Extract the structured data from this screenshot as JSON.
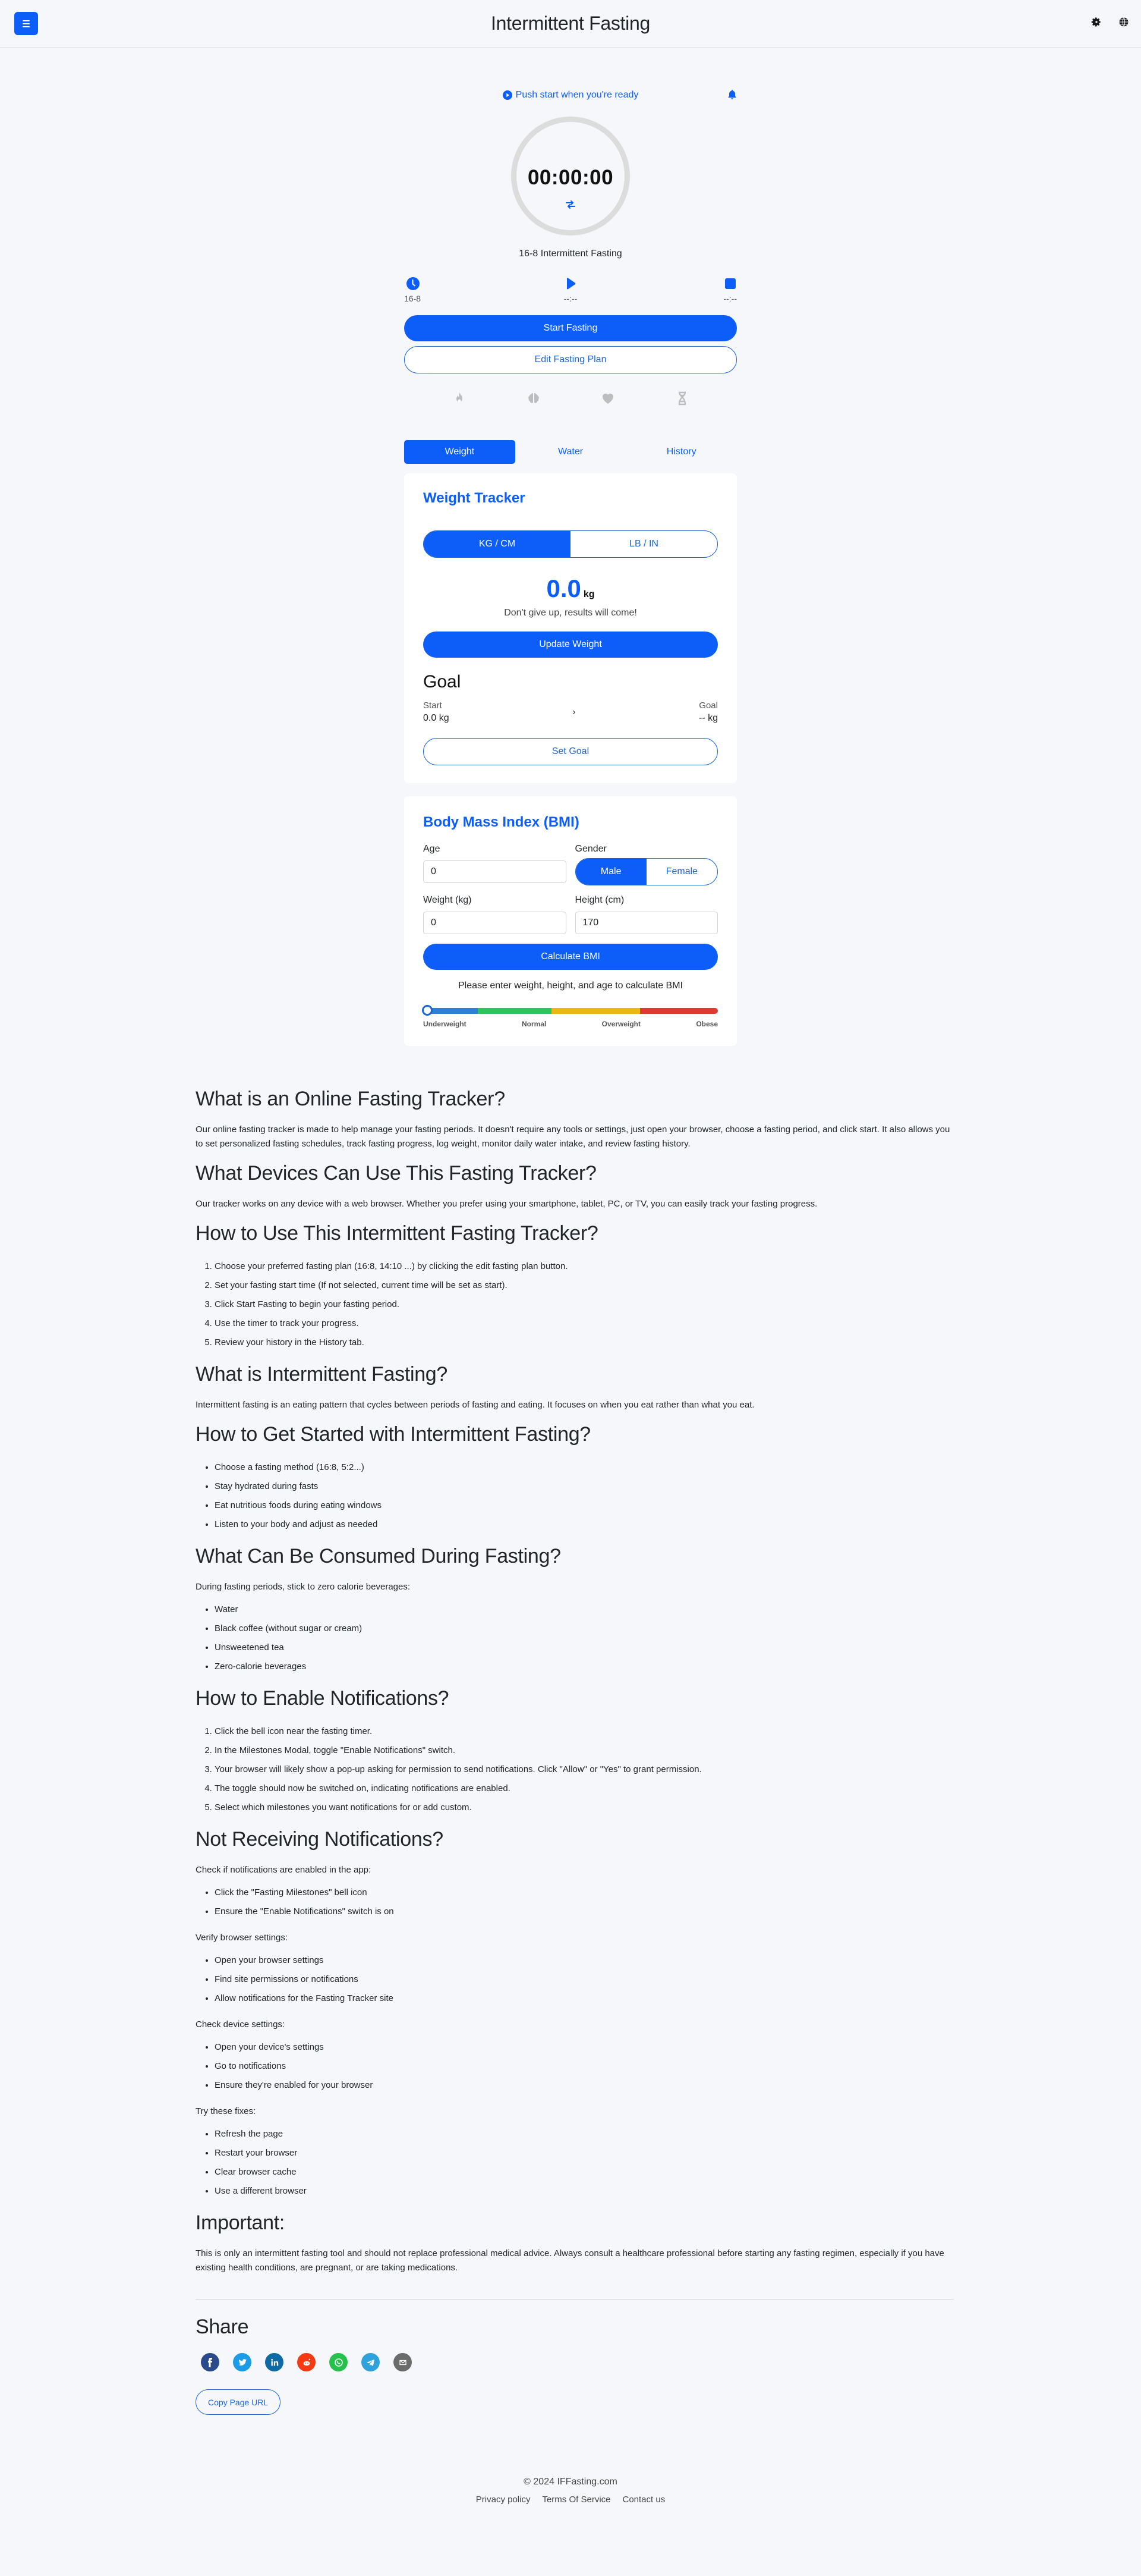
{
  "header": {
    "title": "Intermittent Fasting",
    "menu_icon": "hamburger-menu-icon",
    "settings_icon": "gear-icon",
    "language_icon": "globe-icon"
  },
  "timer": {
    "status_text": "Push start when you're ready",
    "status_icon": "play-circle-icon",
    "notifications_icon": "bell-icon",
    "value": "00:00:00",
    "swap_icon": "swap-arrows-icon",
    "plan_name": "16-8 Intermittent Fasting",
    "meta": [
      {
        "icon": "clock-icon",
        "label": "16-8"
      },
      {
        "icon": "play-icon",
        "label": "--:--"
      },
      {
        "icon": "stop-icon",
        "label": "--:--"
      }
    ],
    "start_button": "Start Fasting",
    "edit_button": "Edit Fasting Plan",
    "benefit_icons": [
      "flame-icon",
      "brain-icon",
      "heart-icon",
      "dna-icon"
    ]
  },
  "tabs": [
    {
      "label": "Weight",
      "active": true
    },
    {
      "label": "Water",
      "active": false
    },
    {
      "label": "History",
      "active": false
    }
  ],
  "weight_tracker": {
    "title": "Weight Tracker",
    "units": [
      {
        "label": "KG / CM",
        "active": true
      },
      {
        "label": "LB / IN",
        "active": false
      }
    ],
    "value": "0.0",
    "unit": "kg",
    "motivation": "Don't give up, results will come!",
    "update_button": "Update Weight",
    "goal": {
      "title": "Goal",
      "start_label": "Start",
      "start_value": "0.0 kg",
      "arrow": "›",
      "goal_label": "Goal",
      "goal_value": "-- kg",
      "set_button": "Set Goal"
    }
  },
  "bmi": {
    "title": "Body Mass Index (BMI)",
    "age_label": "Age",
    "age_value": "0",
    "gender_label": "Gender",
    "gender_options": [
      {
        "label": "Male",
        "active": true
      },
      {
        "label": "Female",
        "active": false
      }
    ],
    "weight_label": "Weight (kg)",
    "weight_value": "0",
    "height_label": "Height (cm)",
    "height_value": "170",
    "calculate_button": "Calculate BMI",
    "message": "Please enter weight, height, and age to calculate BMI",
    "scale": {
      "indicator_fraction": 0.0,
      "segments": [
        {
          "label": "Underweight",
          "color": "#2e7fd6",
          "share": 0.185
        },
        {
          "label": "Normal",
          "color": "#2dc35f",
          "share": 0.25
        },
        {
          "label": "Overweight",
          "color": "#eab812",
          "share": 0.3
        },
        {
          "label": "Obese",
          "color": "#de3a32",
          "share": 0.265
        }
      ]
    }
  },
  "article": {
    "sections": [
      {
        "heading": "What is an Online Fasting Tracker?",
        "paragraphs": [
          "Our online fasting tracker is made to help manage your fasting periods. It doesn't require any tools or settings, just open your browser, choose a fasting period, and click start. It also allows you to set personalized fasting schedules, track fasting progress, log weight, monitor daily water intake, and review fasting history."
        ]
      },
      {
        "heading": "What Devices Can Use This Fasting Tracker?",
        "paragraphs": [
          "Our tracker works on any device with a web browser. Whether you prefer using your smartphone, tablet, PC, or TV, you can easily track your fasting progress."
        ]
      },
      {
        "heading": "How to Use This Intermittent Fasting Tracker?",
        "ordered": [
          "Choose your preferred fasting plan (16:8, 14:10 ...) by clicking the edit fasting plan button.",
          "Set your fasting start time (If not selected, current time will be set as start).",
          "Click Start Fasting to begin your fasting period.",
          "Use the timer to track your progress.",
          "Review your history in the History tab."
        ]
      },
      {
        "heading": "What is Intermittent Fasting?",
        "paragraphs": [
          "Intermittent fasting is an eating pattern that cycles between periods of fasting and eating. It focuses on when you eat rather than what you eat."
        ]
      },
      {
        "heading": "How to Get Started with Intermittent Fasting?",
        "bullets": [
          "Choose a fasting method (16:8, 5:2...)",
          "Stay hydrated during fasts",
          "Eat nutritious foods during eating windows",
          "Listen to your body and adjust as needed"
        ]
      },
      {
        "heading": "What Can Be Consumed During Fasting?",
        "intro": "During fasting periods, stick to zero calorie beverages:",
        "bullets": [
          "Water",
          "Black coffee (without sugar or cream)",
          "Unsweetened tea",
          "Zero-calorie beverages"
        ]
      },
      {
        "heading": "How to Enable Notifications?",
        "ordered": [
          "Click the bell icon near the fasting timer.",
          "In the Milestones Modal, toggle \"Enable Notifications\" switch.",
          "Your browser will likely show a pop-up asking for permission to send notifications. Click \"Allow\" or \"Yes\" to grant permission.",
          "The toggle should now be switched on, indicating notifications are enabled.",
          "Select which milestones you want notifications for or add custom."
        ]
      },
      {
        "heading": "Not Receiving Notifications?",
        "groups": [
          {
            "intro": "Check if notifications are enabled in the app:",
            "bullets": [
              "Click the \"Fasting Milestones\" bell icon",
              "Ensure the \"Enable Notifications\" switch is on"
            ]
          },
          {
            "intro": "Verify browser settings:",
            "bullets": [
              "Open your browser settings",
              "Find site permissions or notifications",
              "Allow notifications for the Fasting Tracker site"
            ]
          },
          {
            "intro": "Check device settings:",
            "bullets": [
              "Open your device's settings",
              "Go to notifications",
              "Ensure they're enabled for your browser"
            ]
          },
          {
            "intro": "Try these fixes:",
            "bullets": [
              "Refresh the page",
              "Restart your browser",
              "Clear browser cache",
              "Use a different browser"
            ]
          }
        ]
      },
      {
        "heading": "Important:",
        "paragraphs": [
          "This is only an intermittent fasting tool and should not replace professional medical advice. Always consult a healthcare professional before starting any fasting regimen, especially if you have existing health conditions, are pregnant, or are taking medications."
        ]
      }
    ]
  },
  "share": {
    "title": "Share",
    "networks": [
      {
        "name": "facebook",
        "icon": "facebook-icon",
        "color": "#2b4a8b"
      },
      {
        "name": "twitter",
        "icon": "twitter-icon",
        "color": "#1c9be6"
      },
      {
        "name": "linkedin",
        "icon": "linkedin-icon",
        "color": "#0e6aa4"
      },
      {
        "name": "reddit",
        "icon": "reddit-icon",
        "color": "#f43a15"
      },
      {
        "name": "whatsapp",
        "icon": "whatsapp-icon",
        "color": "#26c14c"
      },
      {
        "name": "telegram",
        "icon": "telegram-icon",
        "color": "#2fa2dc"
      },
      {
        "name": "email",
        "icon": "email-icon",
        "color": "#6b6b6b"
      }
    ],
    "copy_button": "Copy Page URL"
  },
  "footer": {
    "copyright": "© 2024 IFFasting.com",
    "links": [
      "Privacy policy",
      "Terms Of Service",
      "Contact us"
    ]
  },
  "colors": {
    "primary": "#0d5ef9",
    "outline": "#1b66d2",
    "background": "#f5f7fa",
    "ring": "#dcdcdc",
    "benefit_icon": "#bdbdbd"
  }
}
